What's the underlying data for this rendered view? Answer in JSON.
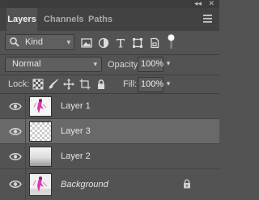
{
  "window": {
    "collapse_glyph": "◂◂",
    "close_glyph": "✕"
  },
  "tabs": [
    {
      "label": "Layers",
      "active": true
    },
    {
      "label": "Channels",
      "active": false
    },
    {
      "label": "Paths",
      "active": false
    }
  ],
  "filter": {
    "kind_label": "Kind",
    "icons": [
      "pixel-filter-icon",
      "adjustment-filter-icon",
      "type-filter-icon",
      "shape-filter-icon",
      "smart-object-filter-icon"
    ]
  },
  "blend": {
    "mode": "Normal",
    "opacity_label": "Opacity:",
    "opacity_value": "100%"
  },
  "lock": {
    "label": "Lock:",
    "fill_label": "Fill:",
    "fill_value": "100%"
  },
  "layers": [
    {
      "name": "Layer 1",
      "visible": true,
      "selected": false,
      "thumbnail": "figure-art"
    },
    {
      "name": "Layer 3",
      "visible": true,
      "selected": true,
      "thumbnail": "transparent"
    },
    {
      "name": "Layer 2",
      "visible": true,
      "selected": false,
      "thumbnail": "gradient"
    },
    {
      "name": "Background",
      "visible": true,
      "selected": false,
      "thumbnail": "figure-art",
      "locked": true
    }
  ],
  "colors": {
    "panel_bg": "#535353",
    "tab_bar": "#424242",
    "selected_row": "#696969",
    "accent_magenta": "#d63ab0"
  }
}
